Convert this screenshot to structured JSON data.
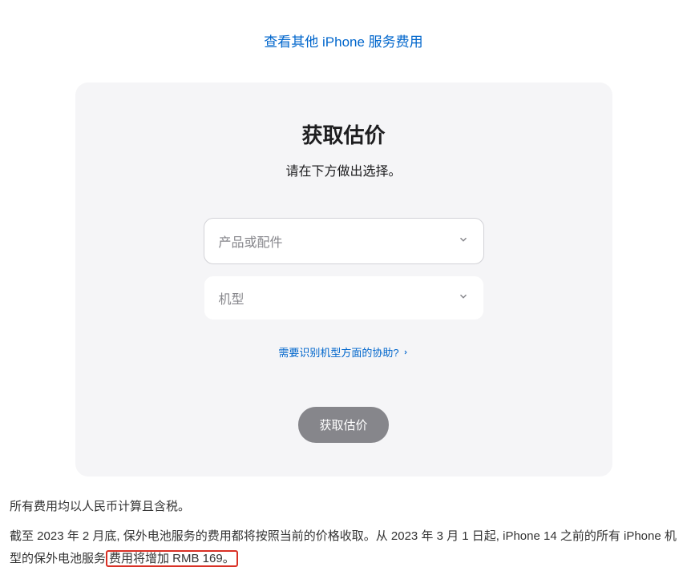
{
  "top_link": "查看其他 iPhone 服务费用",
  "card": {
    "title": "获取估价",
    "subtitle": "请在下方做出选择。",
    "select1_placeholder": "产品或配件",
    "select2_placeholder": "机型",
    "help_link": "需要识别机型方面的协助?",
    "button_label": "获取估价"
  },
  "footer": {
    "line1": "所有费用均以人民币计算且含税。",
    "line2_part1": "截至 2023 年 2 月底, 保外电池服务的费用都将按照当前的价格收取。从 2023 年 3 月 1 日起, iPhone 14 之前的所有 iPhone 机型的保外电池服务",
    "line2_highlight": "费用将增加 RMB 169。"
  }
}
